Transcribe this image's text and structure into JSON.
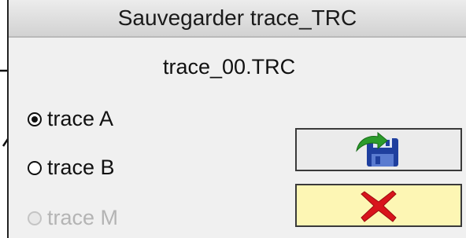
{
  "dialog": {
    "title": "Sauvegarder trace_TRC",
    "filename": "trace_00.TRC"
  },
  "options": [
    {
      "label": "trace A",
      "checked": true,
      "enabled": true
    },
    {
      "label": "trace B",
      "checked": false,
      "enabled": true
    },
    {
      "label": "trace M",
      "checked": false,
      "enabled": false
    }
  ],
  "buttons": {
    "save_icon": "save-floppy-icon",
    "cancel_icon": "red-x-icon"
  },
  "colors": {
    "cancel_bg": "#fdf6b4",
    "cancel_x": "#d8141c",
    "save_floppy": "#1f3f9e",
    "save_arrow": "#2b9b2b"
  }
}
